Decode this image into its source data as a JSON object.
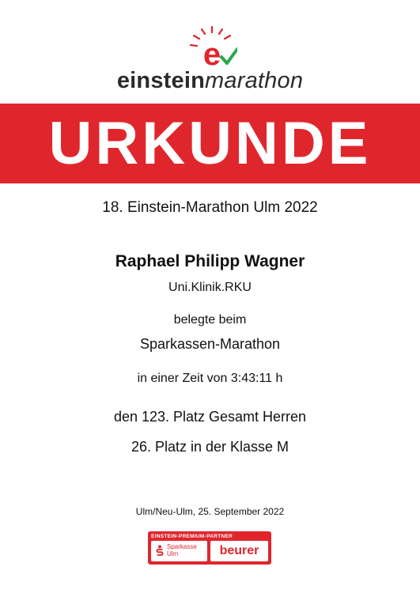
{
  "logo": {
    "name_bold": "einstein",
    "name_light": "marathon",
    "colors": {
      "red": "#e0262d",
      "green": "#2aa84a",
      "text": "#2b2b2b"
    }
  },
  "banner": {
    "title": "URKUNDE",
    "color": "#e0262d"
  },
  "certificate": {
    "event": "18. Einstein-Marathon Ulm 2022",
    "name": "Raphael Philipp Wagner",
    "club": "Uni.Klinik.RKU",
    "intro": "belegte beim",
    "race": "Sparkassen-Marathon",
    "time": "in einer Zeit von 3:43:11 h",
    "overall_place": "den 123. Platz Gesamt Herren",
    "class_place": "26. Platz in der Klasse M",
    "place_date": "Ulm/Neu-Ulm, 25. September 2022"
  },
  "partner": {
    "label": "EINSTEIN-PREMIUM-PARTNER",
    "sponsor1_line1": "Sparkasse",
    "sponsor1_line2": "Ulm",
    "sponsor2": "beurer"
  }
}
